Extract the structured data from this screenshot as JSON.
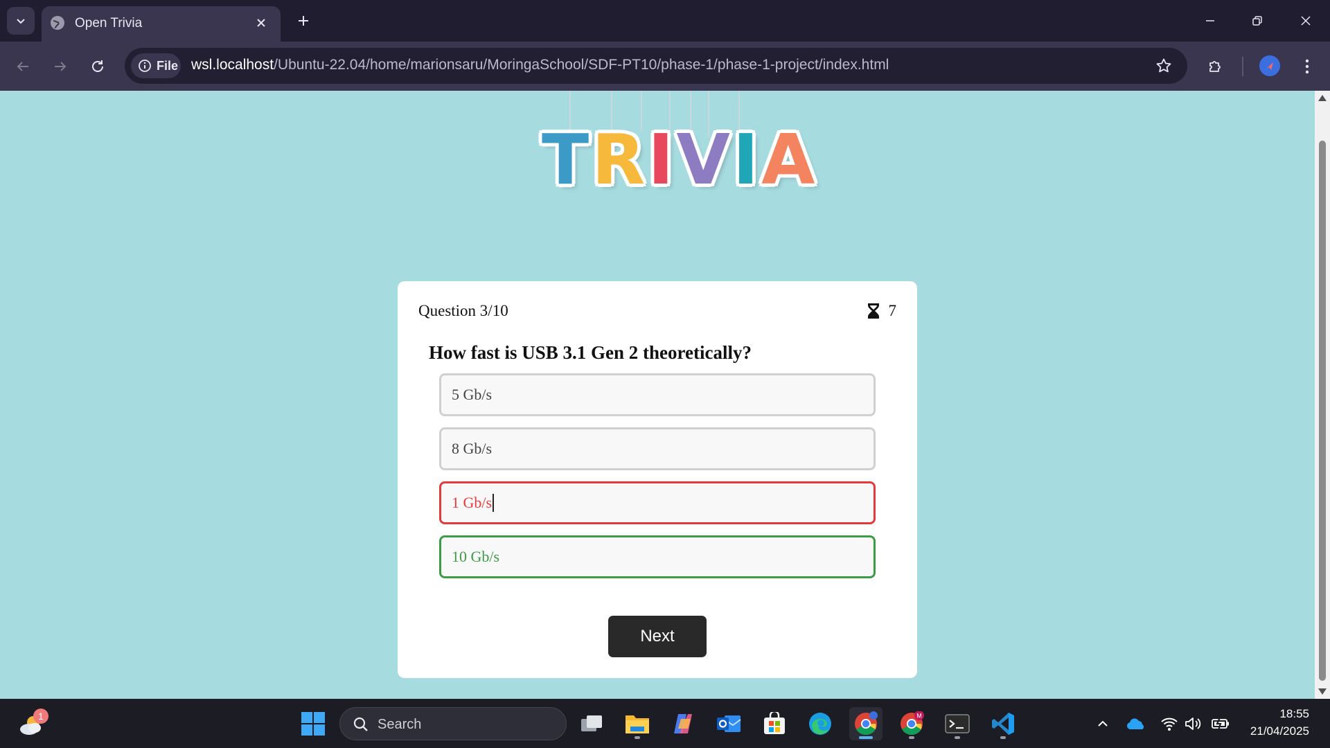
{
  "browser": {
    "tab_title": "Open Trivia",
    "address": {
      "scheme_chip": "File",
      "host": "wsl.localhost",
      "path": "/Ubuntu-22.04/home/marionsaru/MoringaSchool/SDF-PT10/phase-1/phase-1-project/index.html"
    }
  },
  "page": {
    "logo": {
      "text": "TRIVIA",
      "letters": [
        {
          "char": "T",
          "color": "#3b9ac6"
        },
        {
          "char": "R",
          "color": "#f6b93b"
        },
        {
          "char": "I",
          "color": "#e8485c"
        },
        {
          "char": "V",
          "color": "#8e7cc3"
        },
        {
          "char": "I",
          "color": "#1fa7b8"
        },
        {
          "char": "A",
          "color": "#f4845f"
        }
      ]
    },
    "quiz": {
      "counter": "Question 3/10",
      "timer_icon": "hourglass-icon",
      "timer_value": "7",
      "question": "How fast is USB 3.1 Gen 2 theoretically?",
      "options": [
        {
          "label": "5 Gb/s",
          "state": "neutral"
        },
        {
          "label": "8 Gb/s",
          "state": "neutral"
        },
        {
          "label": "1 Gb/s",
          "state": "wrong"
        },
        {
          "label": "10 Gb/s",
          "state": "correct"
        }
      ],
      "next_label": "Next"
    },
    "colors": {
      "background": "#a6dbe0",
      "wrong": "#e6393c",
      "correct": "#3c9b45",
      "button": "#292929"
    }
  },
  "taskbar": {
    "weather_badge": "1",
    "search_placeholder": "Search",
    "apps": [
      "task-view-icon",
      "file-explorer-icon",
      "copilot-icon",
      "outlook-icon",
      "store-icon",
      "edge-icon",
      "chrome-icon",
      "chrome-profile-icon",
      "terminal-icon",
      "vscode-icon"
    ],
    "clock_time": "18:55",
    "clock_date": "21/04/2025"
  }
}
